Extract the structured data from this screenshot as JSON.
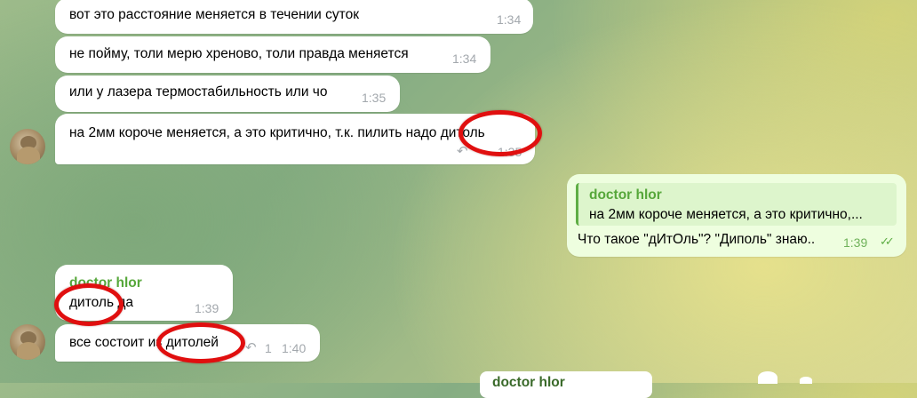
{
  "chat": {
    "messages": [
      {
        "text": "вот это расстояние меняется в течении суток",
        "time": "1:34"
      },
      {
        "text": "не пойму, толи мерю хреново, толи правда меняется",
        "time": "1:34"
      },
      {
        "text": "или у лазера термостабильность или чо",
        "time": "1:35"
      },
      {
        "text": "на 2мм короче меняется, а это критично, т.к. пилить надо дитоль",
        "time": "1:35"
      }
    ],
    "outgoing": {
      "quote_author": "doctor hlor",
      "quote_text": "на 2мм короче меняется, а это критично,...",
      "text": "Что такое \"дИтОль\"? \"Диполь\" знаю..",
      "time": "1:39",
      "status_icon": "double-check-icon"
    },
    "reply1": {
      "sender": "doctor hlor",
      "text": "дитоль да",
      "time": "1:39"
    },
    "reply2": {
      "text": "все состоит из дитолей",
      "reply_count": "1",
      "time": "1:40"
    },
    "bottom_peek": {
      "sender": "doctor hlor"
    }
  },
  "colors": {
    "bubble_in": "#ffffff",
    "bubble_out": "#eefedf",
    "sender": "#56a73a",
    "annotation": "#e00f0f"
  }
}
